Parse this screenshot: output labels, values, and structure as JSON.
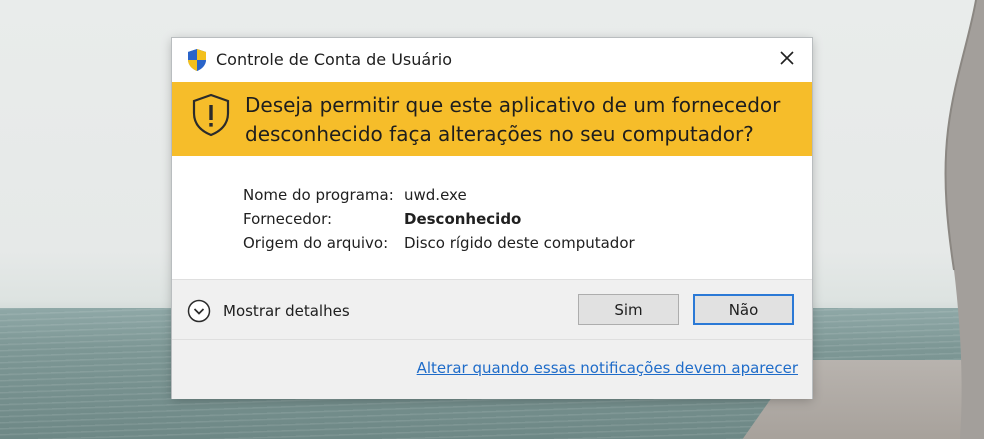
{
  "dialog": {
    "title": "Controle de Conta de Usuário",
    "question": "Deseja permitir que este aplicativo de um fornecedor desconhecido faça alterações no seu computador?",
    "details": [
      {
        "label": "Nome do programa:",
        "value": "uwd.exe",
        "bold": false
      },
      {
        "label": "Fornecedor:",
        "value": "Desconhecido",
        "bold": true
      },
      {
        "label": "Origem do arquivo:",
        "value": "Disco rígido deste computador",
        "bold": false
      }
    ],
    "show_details_label": "Mostrar detalhes",
    "yes_label": "Sim",
    "no_label": "Não",
    "change_settings_link": "Alterar quando essas notificações devem aparecer"
  },
  "colors": {
    "banner": "#f6bd2a",
    "link": "#1f6cc9",
    "focus_border": "#2b79d6"
  },
  "icons": {
    "title": "uac-shield-icon",
    "banner": "warning-shield-icon",
    "close": "close-icon",
    "expand": "chevron-down-circle-icon"
  }
}
